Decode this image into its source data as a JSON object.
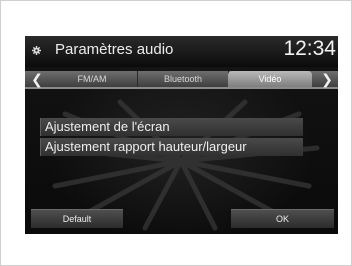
{
  "header": {
    "icon": "gear-icon",
    "title": "Paramètres audio",
    "clock": "12:34"
  },
  "tabs": [
    {
      "label": "FM/AM",
      "active": false
    },
    {
      "label": "Bluetooth",
      "active": false
    },
    {
      "label": "Vidéo",
      "active": true
    }
  ],
  "nav": {
    "prev_icon": "chevron-left-icon",
    "next_icon": "chevron-right-icon"
  },
  "menu": {
    "items": [
      {
        "label": "Ajustement de l'écran"
      },
      {
        "label": "Ajustement rapport hauteur/largeur"
      }
    ]
  },
  "footer": {
    "default_label": "Default",
    "ok_label": "OK"
  },
  "colors": {
    "background": "#0a0a0a",
    "tab_active": "#9a9a9a",
    "text": "#efefef"
  }
}
